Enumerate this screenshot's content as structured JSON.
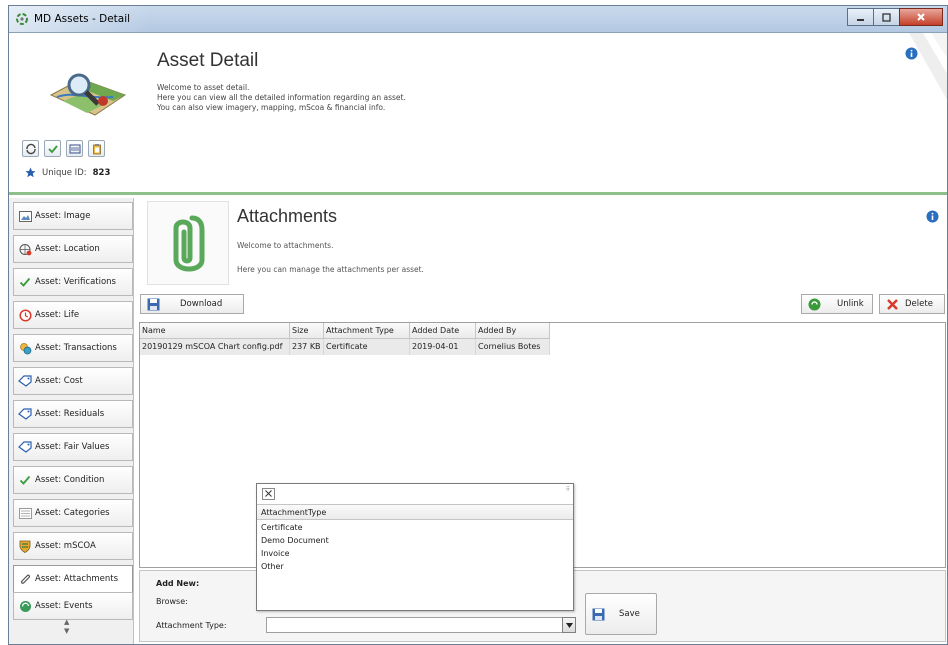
{
  "window": {
    "title": "MD Assets - Detail"
  },
  "header": {
    "title": "Asset Detail",
    "desc_lines": [
      "Welcome to asset detail.",
      "Here you can view all the detailed information regarding an asset.",
      "You can also view imagery, mapping, mScoa & financial info."
    ],
    "uid_label": "Unique ID:",
    "uid_value": "823"
  },
  "sidebar": {
    "items": [
      {
        "label": "Asset: Image",
        "icon": "image-icon"
      },
      {
        "label": "Asset: Location",
        "icon": "globe-pin-icon"
      },
      {
        "label": "Asset: Verifications",
        "icon": "checkmark-icon"
      },
      {
        "label": "Asset: Life",
        "icon": "clock-icon"
      },
      {
        "label": "Asset: Transactions",
        "icon": "coins-icon"
      },
      {
        "label": "Asset: Cost",
        "icon": "tag-icon"
      },
      {
        "label": "Asset: Residuals",
        "icon": "tag-icon"
      },
      {
        "label": "Asset: Fair Values",
        "icon": "tag-icon"
      },
      {
        "label": "Asset: Condition",
        "icon": "checkmark-icon"
      },
      {
        "label": "Asset: Categories",
        "icon": "list-icon"
      },
      {
        "label": "Asset: mSCOA",
        "icon": "coat-of-arms-icon"
      },
      {
        "label": "Asset: Attachments",
        "icon": "paperclip-icon"
      },
      {
        "label": "Asset: Events",
        "icon": "refresh-globe-icon"
      }
    ],
    "active_index": 11
  },
  "attachments": {
    "title": "Attachments",
    "sub1": "Welcome to attachments.",
    "sub2": "Here you can manage the attachments per asset.",
    "download_label": "Download",
    "unlink_label": "Unlink",
    "delete_label": "Delete",
    "columns": [
      "Name",
      "Size",
      "Attachment Type",
      "Added Date",
      "Added By"
    ],
    "rows": [
      [
        "20190129 mSCOA Chart config.pdf",
        "237 KB",
        "Certificate",
        "2019-04-01",
        "Cornelius Botes"
      ]
    ]
  },
  "add_new": {
    "title": "Add New:",
    "browse_label": "Browse:",
    "attachment_type_label": "Attachment Type:",
    "save_label": "Save"
  },
  "dropdown": {
    "column_header": "AttachmentType",
    "options": [
      "Certificate",
      "Demo Document",
      "Invoice",
      "Other"
    ]
  },
  "colors": {
    "accent_green": "#8fbf8a",
    "info_blue": "#2a6fbf",
    "delete_red": "#d83a2a"
  }
}
